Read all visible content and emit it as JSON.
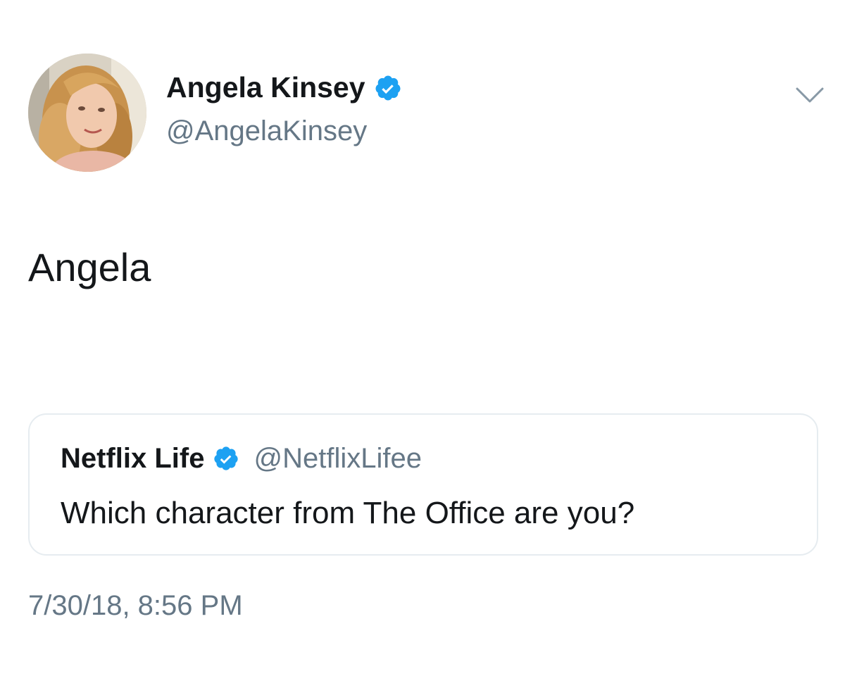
{
  "author": {
    "display_name": "Angela Kinsey",
    "handle": "@AngelaKinsey",
    "verified": true,
    "avatar_icon": "profile-photo"
  },
  "tweet": {
    "text": "Angela",
    "timestamp": "7/30/18, 8:56 PM"
  },
  "quoted_tweet": {
    "display_name": "Netflix Life",
    "handle": "@NetflixLifee",
    "verified": true,
    "text": "Which character from The Office are you?"
  },
  "icons": {
    "verified": "verified-badge-icon",
    "menu": "chevron-down-icon"
  },
  "colors": {
    "verified_blue": "#1da1f2",
    "secondary_text": "#657786",
    "primary_text": "#14171a",
    "card_border": "#e6ecf0"
  }
}
